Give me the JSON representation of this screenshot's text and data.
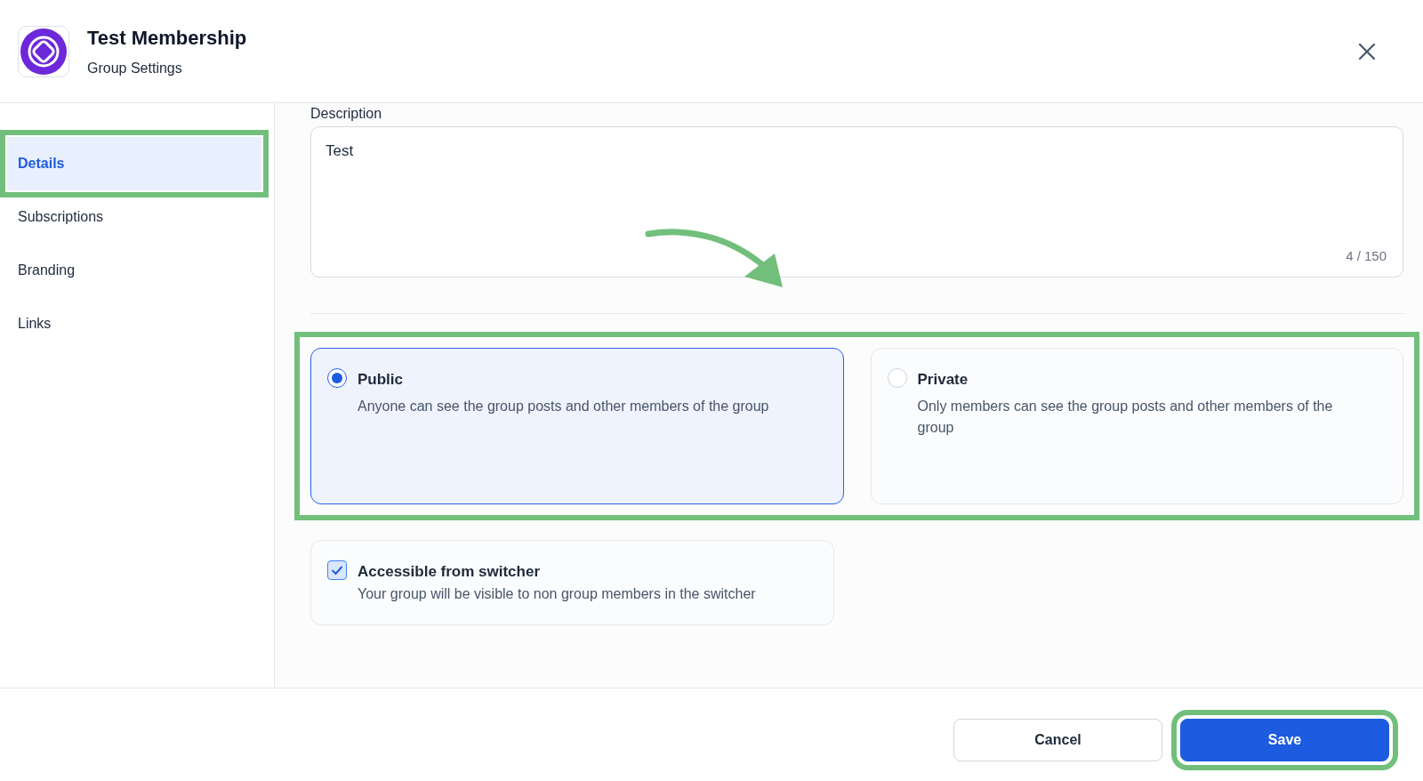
{
  "header": {
    "title": "Test Membership",
    "subtitle": "Group Settings"
  },
  "sidebar": {
    "items": [
      {
        "label": "Details",
        "selected": true,
        "highlighted": true
      },
      {
        "label": "Subscriptions",
        "selected": false,
        "highlighted": false
      },
      {
        "label": "Branding",
        "selected": false,
        "highlighted": false
      },
      {
        "label": "Links",
        "selected": false,
        "highlighted": false
      }
    ]
  },
  "description": {
    "label": "Description",
    "value": "Test",
    "counter": "4 / 150"
  },
  "visibility": {
    "highlighted": true,
    "options": [
      {
        "title": "Public",
        "description": "Anyone can see the group posts and other members of the group",
        "selected": true
      },
      {
        "title": "Private",
        "description": "Only members can see the group posts and other members of the group",
        "selected": false
      }
    ]
  },
  "switcher": {
    "title": "Accessible from switcher",
    "description": "Your group will be visible to non group members in the switcher",
    "checked": true
  },
  "footer": {
    "buttons": [
      {
        "label": "Cancel",
        "kind": "secondary",
        "highlighted": false
      },
      {
        "label": "Save",
        "kind": "primary",
        "highlighted": true
      }
    ]
  }
}
